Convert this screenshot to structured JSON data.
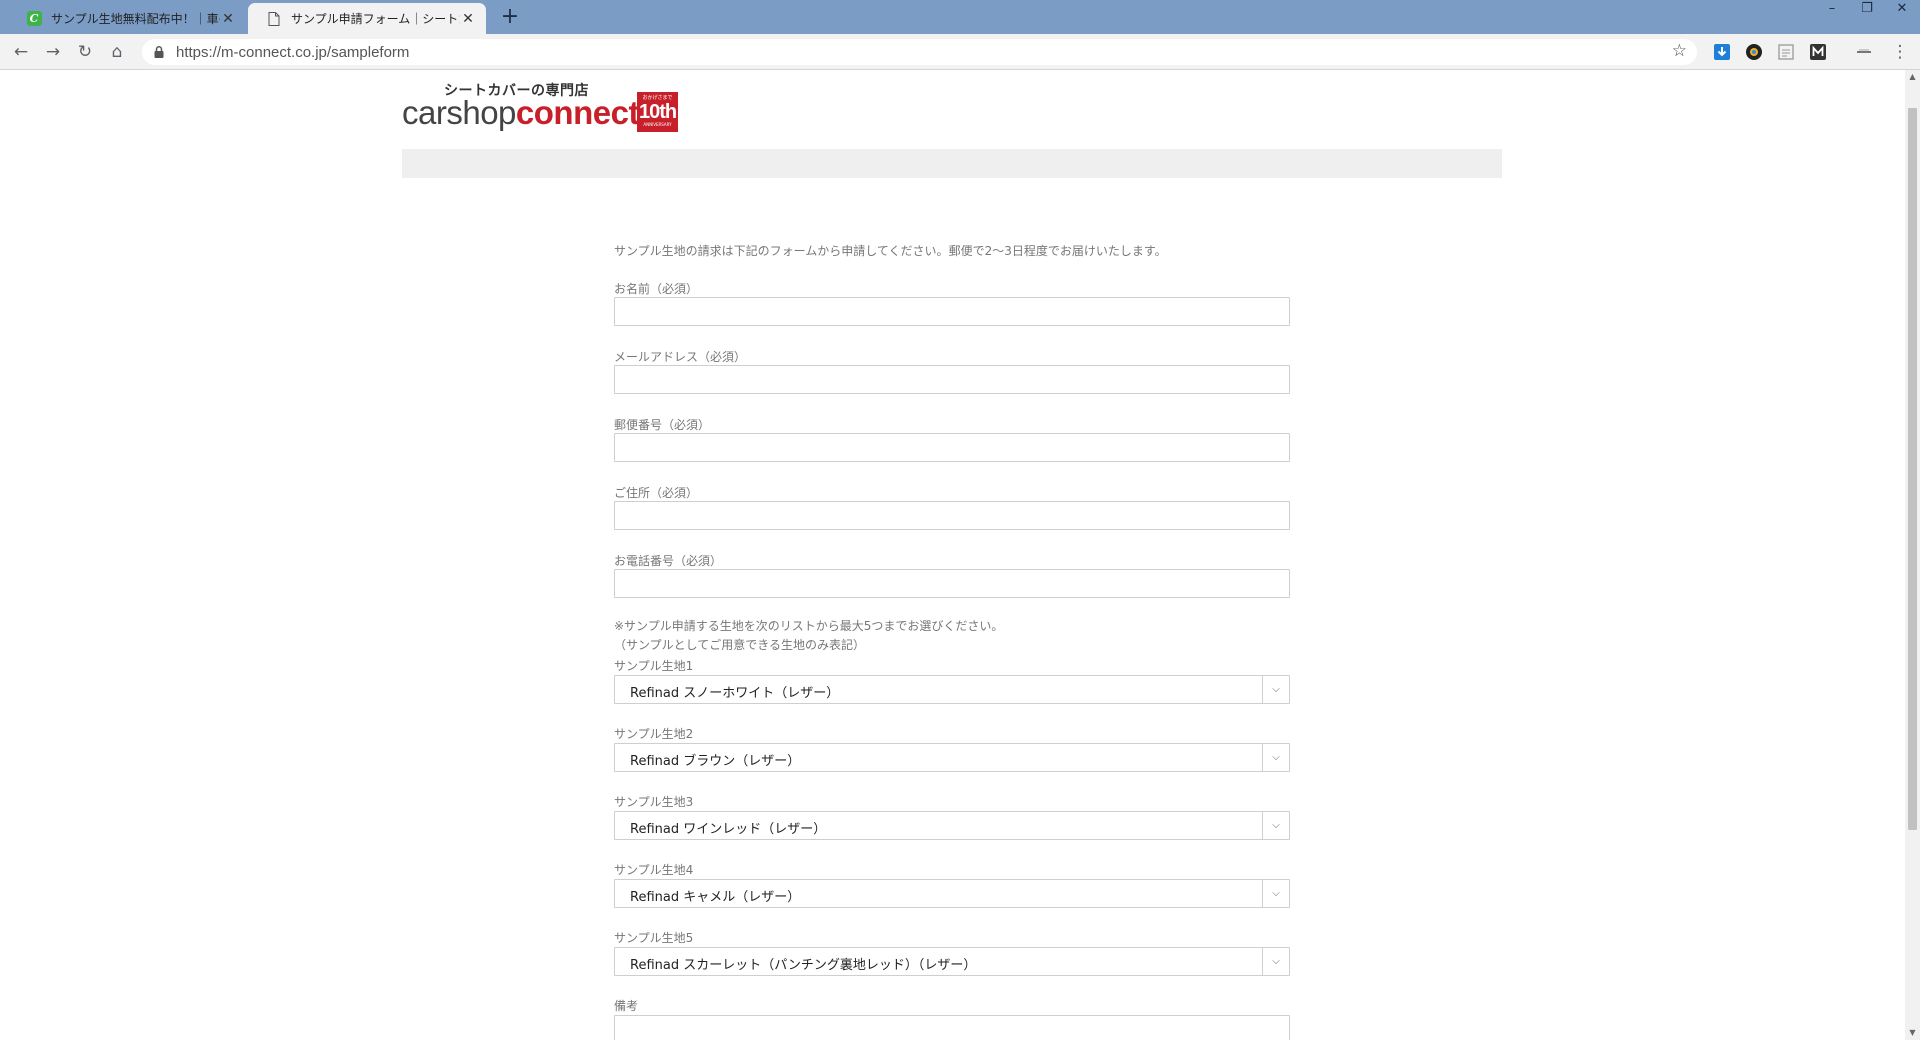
{
  "browser": {
    "tabs": [
      {
        "title": "サンプル生地無料配布中！｜車のシ",
        "active": false
      },
      {
        "title": "サンプル申請フォーム｜シートカバーの",
        "active": true
      }
    ],
    "url": "https://m-connect.co.jp/sampleform"
  },
  "logo": {
    "tagline": "シートカバーの専門店",
    "word_main": "carshop",
    "word_accent": "connect",
    "badge_top": "おかげさまで",
    "badge_num": "10th",
    "badge_bottom": "ANNIVERSARY"
  },
  "form": {
    "intro": "サンプル生地の請求は下記のフォームから申請してください。郵便で2〜3日程度でお届けいたします。",
    "fields": [
      {
        "label": "お名前（必須）",
        "value": ""
      },
      {
        "label": "メールアドレス（必須）",
        "value": ""
      },
      {
        "label": "郵便番号（必須）",
        "value": ""
      },
      {
        "label": "ご住所（必須）",
        "value": ""
      },
      {
        "label": "お電話番号（必須）",
        "value": ""
      }
    ],
    "note_line1": "※サンプル申請する生地を次のリストから最大5つまでお選びください。",
    "note_line2": "（サンプルとしてご用意できる生地のみ表記）",
    "samples": [
      {
        "label": "サンプル生地1",
        "value": "Refinad スノーホワイト（レザー）"
      },
      {
        "label": "サンプル生地2",
        "value": "Refinad ブラウン（レザー）"
      },
      {
        "label": "サンプル生地3",
        "value": "Refinad ワインレッド（レザー）"
      },
      {
        "label": "サンプル生地4",
        "value": "Refinad キャメル（レザー）"
      },
      {
        "label": "サンプル生地5",
        "value": "Refinad スカーレット（パンチング裏地レッド）（レザー）"
      }
    ],
    "remarks_label": "備考"
  },
  "colors": {
    "brand_red": "#c8202a",
    "tabbar": "#7b9cc4"
  }
}
